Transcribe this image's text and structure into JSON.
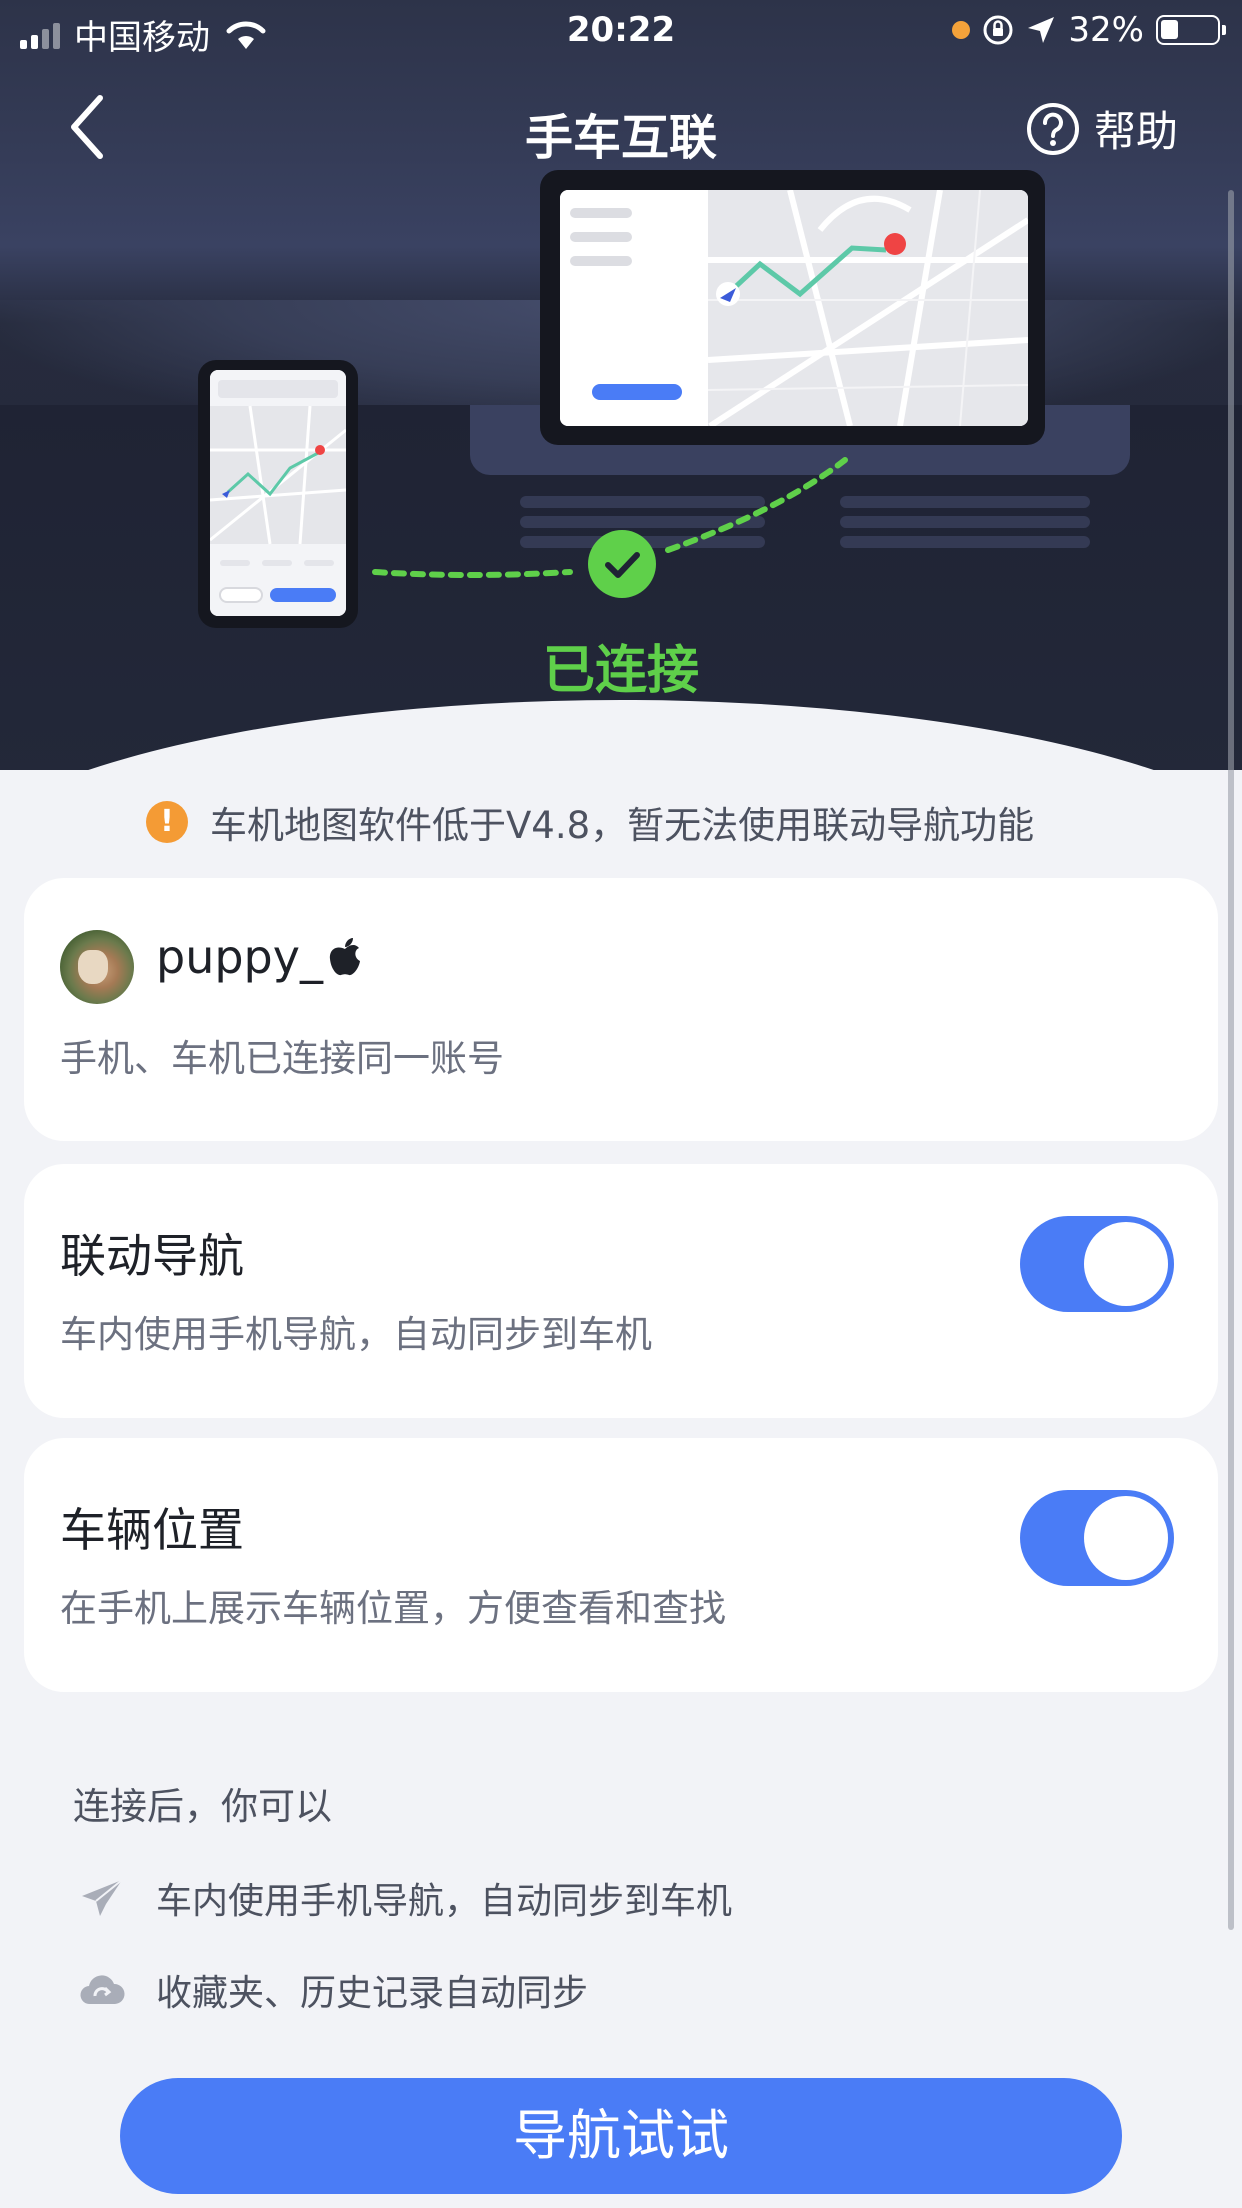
{
  "status_bar": {
    "carrier": "中国移动",
    "time": "20:22",
    "battery": "32%",
    "battery_level": 0.32
  },
  "nav": {
    "title": "手车互联",
    "help_label": "帮助"
  },
  "hero": {
    "connection_status": "已连接",
    "colors": {
      "accent_green": "#5fd04a",
      "route": "#5dc9a8",
      "pin": "#ef4444",
      "primary_blue": "#4a7cf6"
    }
  },
  "warning": {
    "icon": "!",
    "text": "车机地图软件低于V4.8，暂无法使用联动导航功能"
  },
  "account": {
    "username": "puppy_",
    "username_suffix": "",
    "description": "手机、车机已连接同一账号"
  },
  "settings": [
    {
      "title": "联动导航",
      "description": "车内使用手机导航，自动同步到车机",
      "enabled": true
    },
    {
      "title": "车辆位置",
      "description": "在手机上展示车辆位置，方便查看和查找",
      "enabled": true
    }
  ],
  "features": {
    "title": "连接后，你可以",
    "items": [
      {
        "icon": "paper-plane-icon",
        "text": "车内使用手机导航，自动同步到车机"
      },
      {
        "icon": "cloud-sync-icon",
        "text": "收藏夹、历史记录自动同步"
      }
    ]
  },
  "cta": {
    "label": "导航试试"
  }
}
